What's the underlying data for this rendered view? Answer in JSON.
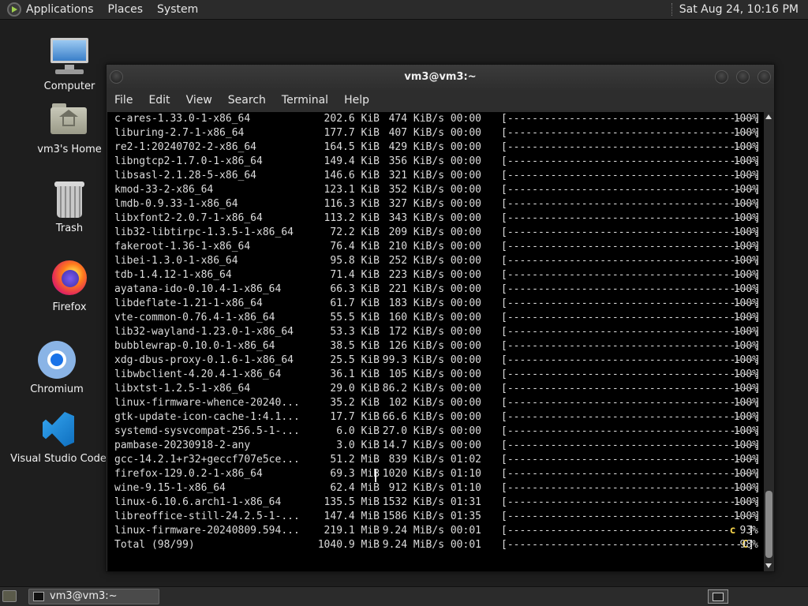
{
  "top_panel": {
    "menus": [
      "Applications",
      "Places",
      "System"
    ],
    "clock": "Sat Aug 24, 10:16 PM"
  },
  "desktop_icons": [
    {
      "label": "Computer",
      "icon": "computer-icon"
    },
    {
      "label": "vm3's Home",
      "icon": "home-folder-icon"
    },
    {
      "label": "Trash",
      "icon": "trash-icon"
    },
    {
      "label": "Firefox",
      "icon": "firefox-icon"
    },
    {
      "label": "Chromium",
      "icon": "chromium-icon"
    },
    {
      "label": "Visual Studio Code",
      "icon": "vscode-icon"
    }
  ],
  "terminal": {
    "title": "vm3@vm3:~",
    "menu": [
      "File",
      "Edit",
      "View",
      "Search",
      "Terminal",
      "Help"
    ],
    "lines": [
      {
        "pkg": "c-ares-1.33.0-1-x86_64",
        "size": "202.6 KiB",
        "speed": "474 KiB/s 00:00",
        "bar": "[----------------------------------------]",
        "pct": "100%"
      },
      {
        "pkg": "liburing-2.7-1-x86_64",
        "size": "177.7 KiB",
        "speed": "407 KiB/s 00:00",
        "bar": "[----------------------------------------]",
        "pct": "100%"
      },
      {
        "pkg": "re2-1:20240702-2-x86_64",
        "size": "164.5 KiB",
        "speed": "429 KiB/s 00:00",
        "bar": "[----------------------------------------]",
        "pct": "100%"
      },
      {
        "pkg": "libngtcp2-1.7.0-1-x86_64",
        "size": "149.4 KiB",
        "speed": "356 KiB/s 00:00",
        "bar": "[----------------------------------------]",
        "pct": "100%"
      },
      {
        "pkg": "libsasl-2.1.28-5-x86_64",
        "size": "146.6 KiB",
        "speed": "321 KiB/s 00:00",
        "bar": "[----------------------------------------]",
        "pct": "100%"
      },
      {
        "pkg": "kmod-33-2-x86_64",
        "size": "123.1 KiB",
        "speed": "352 KiB/s 00:00",
        "bar": "[----------------------------------------]",
        "pct": "100%"
      },
      {
        "pkg": "lmdb-0.9.33-1-x86_64",
        "size": "116.3 KiB",
        "speed": "327 KiB/s 00:00",
        "bar": "[----------------------------------------]",
        "pct": "100%"
      },
      {
        "pkg": "libxfont2-2.0.7-1-x86_64",
        "size": "113.2 KiB",
        "speed": "343 KiB/s 00:00",
        "bar": "[----------------------------------------]",
        "pct": "100%"
      },
      {
        "pkg": "lib32-libtirpc-1.3.5-1-x86_64",
        "size": "72.2 KiB",
        "speed": "209 KiB/s 00:00",
        "bar": "[----------------------------------------]",
        "pct": "100%"
      },
      {
        "pkg": "fakeroot-1.36-1-x86_64",
        "size": "76.4 KiB",
        "speed": "210 KiB/s 00:00",
        "bar": "[----------------------------------------]",
        "pct": "100%"
      },
      {
        "pkg": "libei-1.3.0-1-x86_64",
        "size": "95.8 KiB",
        "speed": "252 KiB/s 00:00",
        "bar": "[----------------------------------------]",
        "pct": "100%"
      },
      {
        "pkg": "tdb-1.4.12-1-x86_64",
        "size": "71.4 KiB",
        "speed": "223 KiB/s 00:00",
        "bar": "[----------------------------------------]",
        "pct": "100%"
      },
      {
        "pkg": "ayatana-ido-0.10.4-1-x86_64",
        "size": "66.3 KiB",
        "speed": "221 KiB/s 00:00",
        "bar": "[----------------------------------------]",
        "pct": "100%"
      },
      {
        "pkg": "libdeflate-1.21-1-x86_64",
        "size": "61.7 KiB",
        "speed": "183 KiB/s 00:00",
        "bar": "[----------------------------------------]",
        "pct": "100%"
      },
      {
        "pkg": "vte-common-0.76.4-1-x86_64",
        "size": "55.5 KiB",
        "speed": "160 KiB/s 00:00",
        "bar": "[----------------------------------------]",
        "pct": "100%"
      },
      {
        "pkg": "lib32-wayland-1.23.0-1-x86_64",
        "size": "53.3 KiB",
        "speed": "172 KiB/s 00:00",
        "bar": "[----------------------------------------]",
        "pct": "100%"
      },
      {
        "pkg": "bubblewrap-0.10.0-1-x86_64",
        "size": "38.5 KiB",
        "speed": "126 KiB/s 00:00",
        "bar": "[----------------------------------------]",
        "pct": "100%"
      },
      {
        "pkg": "xdg-dbus-proxy-0.1.6-1-x86_64",
        "size": "25.5 KiB",
        "speed": "99.3 KiB/s 00:00",
        "bar": "[----------------------------------------]",
        "pct": "100%"
      },
      {
        "pkg": "libwbclient-4.20.4-1-x86_64",
        "size": "36.1 KiB",
        "speed": "105 KiB/s 00:00",
        "bar": "[----------------------------------------]",
        "pct": "100%"
      },
      {
        "pkg": "libxtst-1.2.5-1-x86_64",
        "size": "29.0 KiB",
        "speed": "86.2 KiB/s 00:00",
        "bar": "[----------------------------------------]",
        "pct": "100%"
      },
      {
        "pkg": "linux-firmware-whence-20240...",
        "size": "35.2 KiB",
        "speed": "102 KiB/s 00:00",
        "bar": "[----------------------------------------]",
        "pct": "100%"
      },
      {
        "pkg": "gtk-update-icon-cache-1:4.1...",
        "size": "17.7 KiB",
        "speed": "66.6 KiB/s 00:00",
        "bar": "[----------------------------------------]",
        "pct": "100%"
      },
      {
        "pkg": "systemd-sysvcompat-256.5-1-...",
        "size": "6.0 KiB",
        "speed": "27.0 KiB/s 00:00",
        "bar": "[----------------------------------------]",
        "pct": "100%"
      },
      {
        "pkg": "pambase-20230918-2-any",
        "size": "3.0 KiB",
        "speed": "14.7 KiB/s 00:00",
        "bar": "[----------------------------------------]",
        "pct": "100%"
      },
      {
        "pkg": "gcc-14.2.1+r32+geccf707e5ce...",
        "size": "51.2 MiB",
        "speed": "839 KiB/s 01:02",
        "bar": "[----------------------------------------]",
        "pct": "100%"
      },
      {
        "pkg": "firefox-129.0.2-1-x86_64",
        "size": "69.3 MiB",
        "speed": "1020 KiB/s 01:10",
        "bar": "[----------------------------------------]",
        "pct": "100%"
      },
      {
        "pkg": "wine-9.15-1-x86_64",
        "size": "62.4 MiB",
        "speed": "912 KiB/s 01:10",
        "bar": "[----------------------------------------]",
        "pct": "100%"
      },
      {
        "pkg": "linux-6.10.6.arch1-1-x86_64",
        "size": "135.5 MiB",
        "speed": "1532 KiB/s 01:31",
        "bar": "[----------------------------------------]",
        "pct": "100%"
      },
      {
        "pkg": "libreoffice-still-24.2.5-1-...",
        "size": "147.4 MiB",
        "speed": "1586 KiB/s 01:35",
        "bar": "[----------------------------------------]",
        "pct": "100%"
      },
      {
        "pkg": "linux-firmware-20240809.594...",
        "size": "219.1 MiB",
        "speed": "9.24 MiB/s 00:01",
        "bar": "[------------------------------------",
        "pacman": "c",
        "bar_end": "  ]",
        "pct": "93%"
      },
      {
        "pkg": "Total (98/99)",
        "size": "1040.9 MiB",
        "speed": "9.24 MiB/s 00:01",
        "bar": "[--------------------------------------",
        "pacman": "C",
        "bar_end": "]",
        "pct": "98%"
      }
    ]
  },
  "taskbar": {
    "window_button": "vm3@vm3:~"
  }
}
